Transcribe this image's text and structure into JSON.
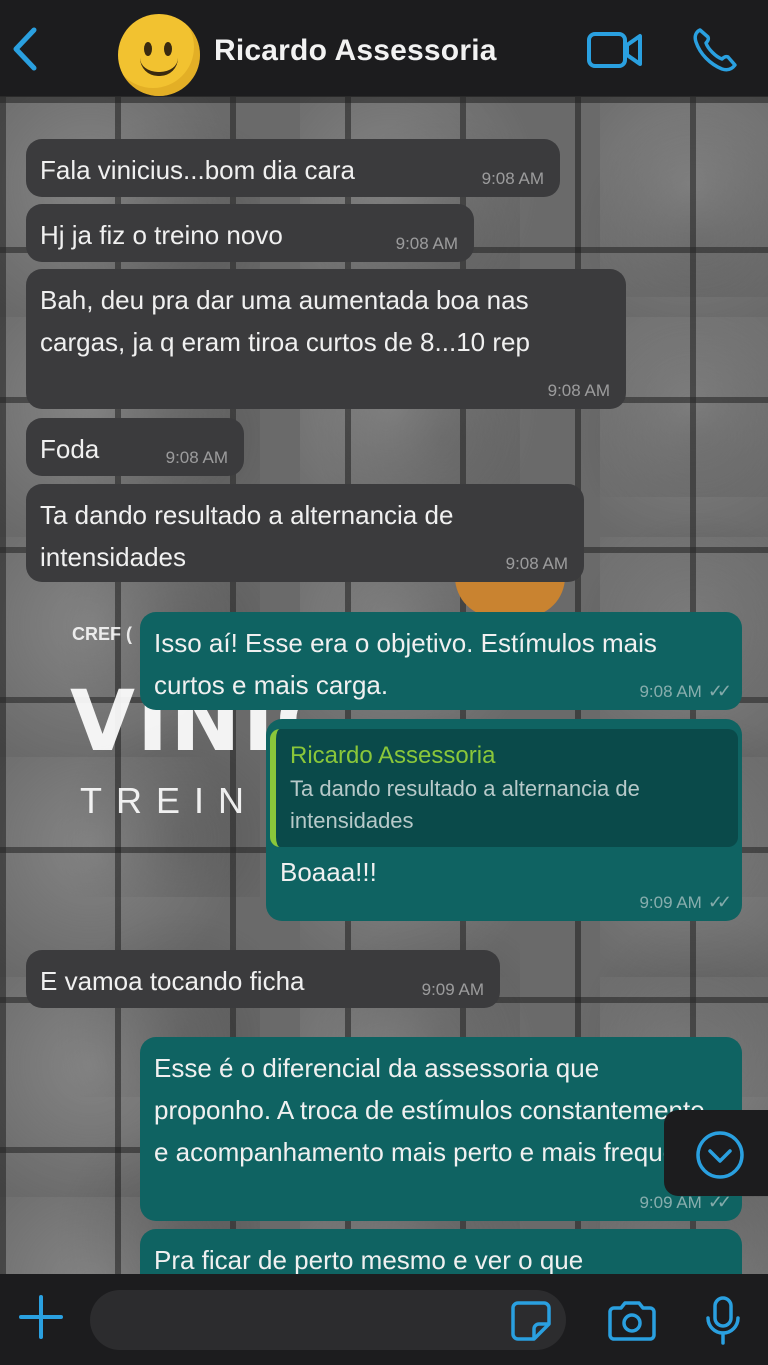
{
  "header": {
    "contact_name": "Ricardo Assessoria"
  },
  "icons": {
    "back": "chevron-left-icon",
    "video": "video-camera-icon",
    "call": "phone-icon",
    "scroll": "chevron-down-circle-icon",
    "plus": "plus-icon",
    "sticker": "sticker-icon",
    "camera": "camera-icon",
    "mic": "microphone-icon"
  },
  "colors": {
    "accent": "#2aa0e0",
    "incoming_bubble": "#3b3b3d",
    "outgoing_bubble": "#0f6362",
    "quote_name": "#8ac73a"
  },
  "background_logo": {
    "cref": "CREF (",
    "title": "VINIC",
    "subtitle": "TREIN"
  },
  "messages": [
    {
      "text": "Fala vinicius...bom dia cara",
      "time": "9:08 AM",
      "direction": "in"
    },
    {
      "text": "Hj ja fiz o treino novo",
      "time": "9:08 AM",
      "direction": "in"
    },
    {
      "text": "Bah, deu pra dar uma aumentada boa nas cargas, ja q eram tiroa curtos de 8...10 rep",
      "time": "9:08 AM",
      "direction": "in"
    },
    {
      "text": "Foda",
      "time": "9:08 AM",
      "direction": "in"
    },
    {
      "text": "Ta dando resultado a alternancia de intensidades",
      "time": "9:08 AM",
      "direction": "in"
    },
    {
      "text": "Isso aí! Esse era o objetivo. Estímulos mais curtos e mais carga.",
      "time": "9:08 AM",
      "direction": "out"
    },
    {
      "quote_name": "Ricardo Assessoria",
      "quote_text": "Ta dando resultado a alternancia de intensidades",
      "text": "Boaaa!!!",
      "time": "9:09 AM",
      "direction": "out"
    },
    {
      "text": "E vamoa tocando ficha",
      "time": "9:09 AM",
      "direction": "in"
    },
    {
      "text": "Esse é o diferencial da assessoria que proponho. A troca de estímulos constantemente e acompanhamento mais perto e mais frequente.",
      "time": "9:09 AM",
      "direction": "out"
    },
    {
      "text": "Pra ficar de perto mesmo e ver o que",
      "time": "",
      "direction": "out"
    }
  ],
  "composer": {
    "placeholder": ""
  }
}
